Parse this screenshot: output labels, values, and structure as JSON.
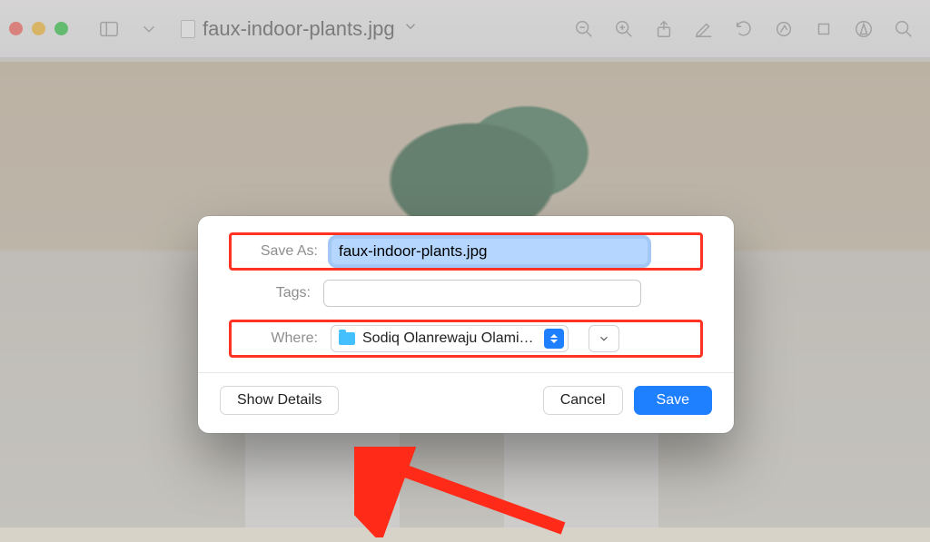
{
  "toolbar": {
    "filename": "faux-indoor-plants.jpg"
  },
  "dialog": {
    "save_as_label": "Save As:",
    "filename_value": "faux-indoor-plants.jpg",
    "tags_label": "Tags:",
    "tags_value": "",
    "where_label": "Where:",
    "where_folder": "Sodiq Olanrewaju Olamid…",
    "show_details_label": "Show Details",
    "cancel_label": "Cancel",
    "save_label": "Save"
  }
}
